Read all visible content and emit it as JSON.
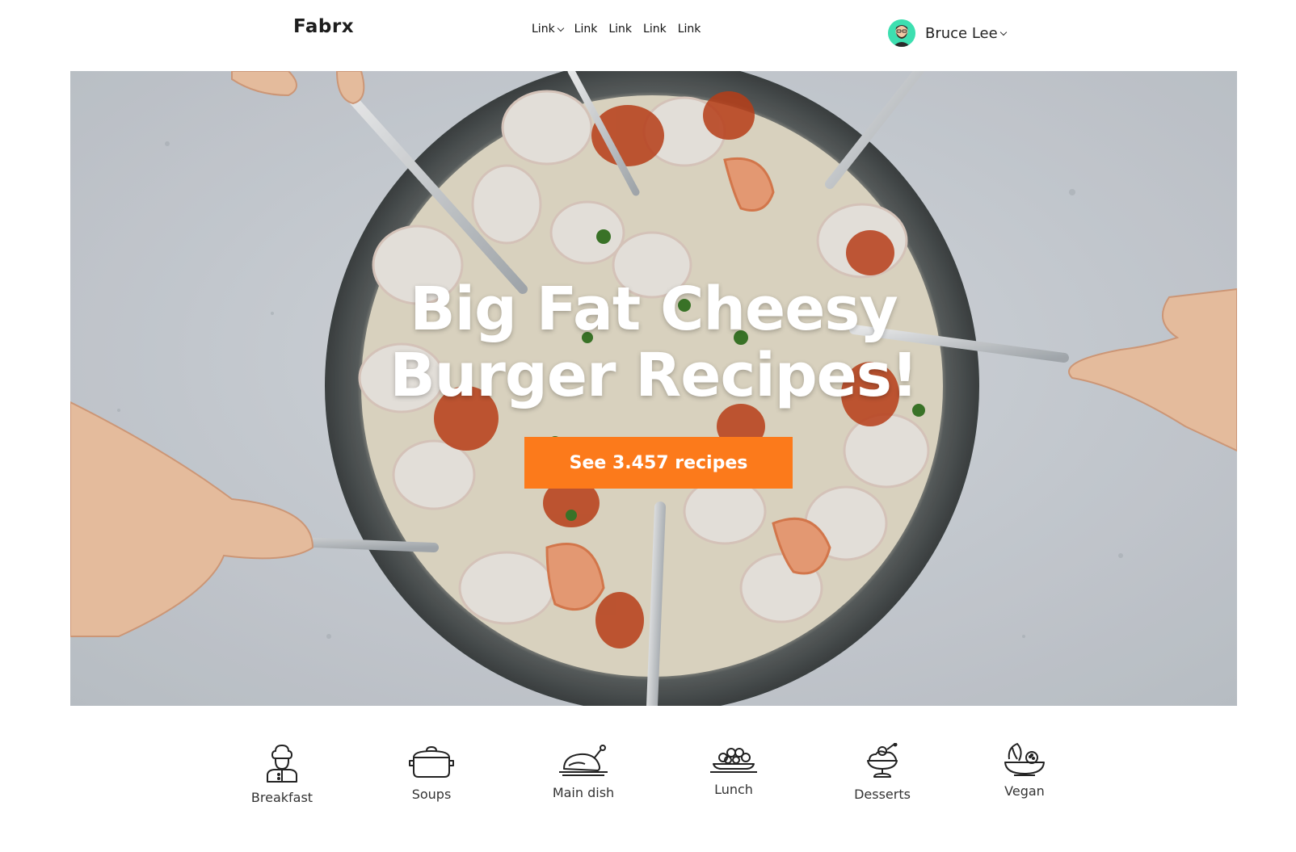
{
  "header": {
    "brand": "Fabrx",
    "nav": [
      {
        "label": "Link",
        "dropdown": true
      },
      {
        "label": "Link",
        "dropdown": false
      },
      {
        "label": "Link",
        "dropdown": false
      },
      {
        "label": "Link",
        "dropdown": false
      },
      {
        "label": "Link",
        "dropdown": false
      }
    ],
    "user": {
      "name": "Bruce Lee",
      "avatar_icon": "bearded-man-avatar",
      "avatar_color": "#3ddfb0"
    }
  },
  "hero": {
    "title_line1": "Big Fat Cheesy",
    "title_line2": "Burger Recipes!",
    "cta_label": "See 3.457 recipes",
    "cta_color": "#fc7a1b"
  },
  "categories": [
    {
      "label": "Breakfast",
      "icon": "chef-icon"
    },
    {
      "label": "Soups",
      "icon": "pot-icon"
    },
    {
      "label": "Main dish",
      "icon": "roast-chicken-icon"
    },
    {
      "label": "Lunch",
      "icon": "lunch-tray-icon"
    },
    {
      "label": "Desserts",
      "icon": "dessert-cup-icon"
    },
    {
      "label": "Vegan",
      "icon": "vegan-bowl-icon"
    }
  ]
}
